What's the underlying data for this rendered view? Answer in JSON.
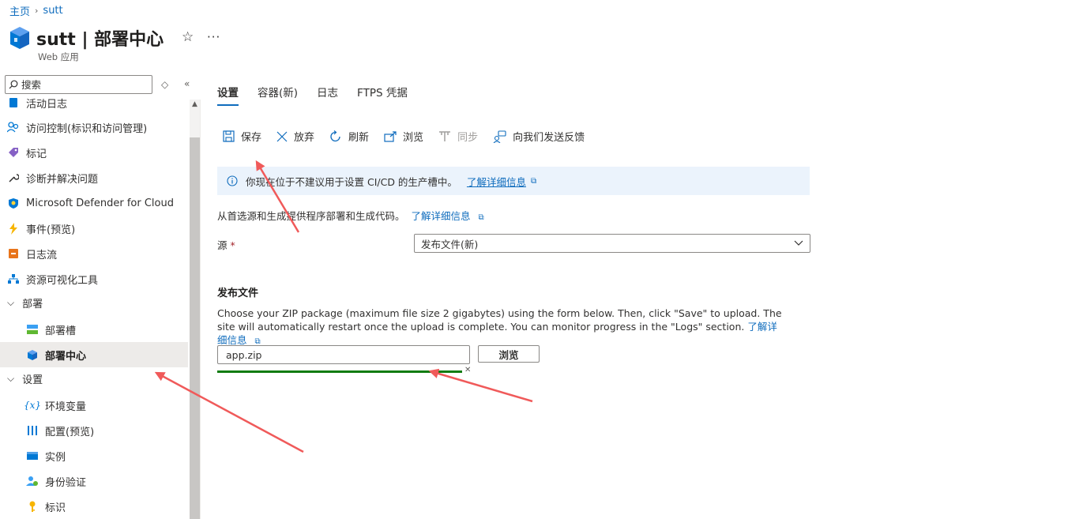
{
  "breadcrumb": {
    "home": "主页",
    "current": "sutt"
  },
  "header": {
    "title": "sutt | 部署中心",
    "subtitle": "Web 应用",
    "star": "☆",
    "more": "···"
  },
  "sidebar": {
    "search_placeholder": "搜索",
    "items": [
      {
        "label": "活动日志",
        "icon": "activity-log-icon"
      },
      {
        "label": "访问控制(标识和访问管理)",
        "icon": "people-icon"
      },
      {
        "label": "标记",
        "icon": "tag-icon"
      },
      {
        "label": "诊断并解决问题",
        "icon": "wrench-icon"
      },
      {
        "label": "Microsoft Defender for Cloud",
        "icon": "shield-icon"
      },
      {
        "label": "事件(预览)",
        "icon": "lightning-icon"
      },
      {
        "label": "日志流",
        "icon": "log-stream-icon"
      },
      {
        "label": "资源可视化工具",
        "icon": "hierarchy-icon"
      },
      {
        "label": "部署",
        "group": true
      },
      {
        "label": "部署槽",
        "icon": "slots-icon"
      },
      {
        "label": "部署中心",
        "icon": "cube-icon",
        "active": true
      },
      {
        "label": "设置",
        "group": true
      },
      {
        "label": "环境变量",
        "icon": "variable-icon"
      },
      {
        "label": "配置(预览)",
        "icon": "config-icon"
      },
      {
        "label": "实例",
        "icon": "instance-icon"
      },
      {
        "label": "身份验证",
        "icon": "auth-icon"
      },
      {
        "label": "标识",
        "icon": "key-icon"
      }
    ]
  },
  "tabs": [
    "设置",
    "容器(新)",
    "日志",
    "FTPS 凭据"
  ],
  "toolbar": {
    "save": "保存",
    "discard": "放弃",
    "refresh": "刷新",
    "browse": "浏览",
    "sync": "同步",
    "feedback": "向我们发送反馈"
  },
  "info_banner": {
    "text": "你现在位于不建议用于设置 CI/CD 的生产槽中。",
    "link": "了解详细信息"
  },
  "description": {
    "text": "从首选源和生成提供程序部署和生成代码。",
    "link": "了解详细信息"
  },
  "source": {
    "label": "源",
    "required_mark": "*",
    "value": "发布文件(新)"
  },
  "publish_file": {
    "title": "发布文件",
    "instructions": "Choose your ZIP package (maximum file size 2 gigabytes) using the form below. Then, click \"Save\" to upload. The site will automatically restart once the upload is complete. You can monitor progress in the \"Logs\" section.",
    "link": "了解详细信息",
    "file_value": "app.zip",
    "browse_label": "浏览",
    "progress": 1.0
  },
  "colors": {
    "accent": "#0f6cbd",
    "progress": "#107c10",
    "annotation_arrow": "#f05a5a"
  }
}
